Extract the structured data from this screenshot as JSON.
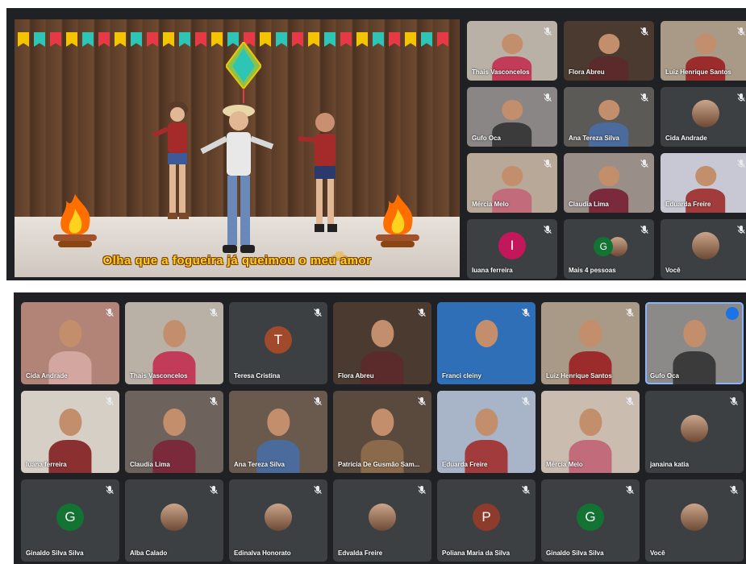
{
  "top_call": {
    "lyric": "Olha que a fogueira já queimou o meu amor",
    "tiles": [
      {
        "name": "Thais Vasconcelos",
        "kind": "video",
        "bg": "#b9b1a6",
        "shirt": "#c23b58"
      },
      {
        "name": "Flora Abreu",
        "kind": "video",
        "bg": "#4a3a30",
        "shirt": "#5b2b2b"
      },
      {
        "name": "Luiz Henrique Santos",
        "kind": "video",
        "bg": "#a89a86",
        "shirt": "#9c2b2b"
      },
      {
        "name": "Gufo Oca",
        "kind": "video",
        "bg": "#8a8686",
        "shirt": "#3b3b3b"
      },
      {
        "name": "Ana Tereza Silva",
        "kind": "video",
        "bg": "#5c5a56",
        "shirt": "#4b6b9c"
      },
      {
        "name": "Cida Andrade",
        "kind": "photo"
      },
      {
        "name": "Mércia Melo",
        "kind": "video",
        "bg": "#b8a898",
        "shirt": "#c26b7a"
      },
      {
        "name": "Claudia Lima",
        "kind": "video",
        "bg": "#9a8e88",
        "shirt": "#7a2a3a"
      },
      {
        "name": "Eduarda Freire",
        "kind": "video",
        "bg": "#c8c8d4",
        "shirt": "#a23b3b"
      },
      {
        "name": "Iuana ferreira",
        "kind": "letter",
        "letter": "I",
        "color": "#c2185b"
      },
      {
        "name": "Mais 4 pessoas",
        "kind": "more",
        "letter": "G",
        "color": "#137333"
      },
      {
        "name": "Você",
        "kind": "photo"
      }
    ]
  },
  "bottom_call": {
    "tiles": [
      {
        "name": "Cida Andrade",
        "kind": "video",
        "bg": "#b28478",
        "shirt": "#d4a6a0"
      },
      {
        "name": "Thais Vasconcelos",
        "kind": "video",
        "bg": "#b9b1a6",
        "shirt": "#c23b58"
      },
      {
        "name": "Teresa Cristina",
        "kind": "letter",
        "letter": "T",
        "color": "#a14a2b"
      },
      {
        "name": "Flora Abreu",
        "kind": "video",
        "bg": "#4a3a30",
        "shirt": "#5b2b2b"
      },
      {
        "name": "Franci cleiny",
        "kind": "video",
        "bg": "#2f6fb8",
        "shirt": "#2f6fb8"
      },
      {
        "name": "Luiz Henrique Santos",
        "kind": "video",
        "bg": "#a89a86",
        "shirt": "#9c2b2b"
      },
      {
        "name": "Gufo Oca",
        "kind": "video",
        "bg": "#8c8a88",
        "shirt": "#3b3b3b",
        "speaking": true
      },
      {
        "name": "Iuana ferreira",
        "kind": "video",
        "bg": "#d6cfc6",
        "shirt": "#8a3030"
      },
      {
        "name": "Claudia Lima",
        "kind": "video",
        "bg": "#6e625c",
        "shirt": "#7a2a3a"
      },
      {
        "name": "Ana Tereza Silva",
        "kind": "video",
        "bg": "#6a5a4e",
        "shirt": "#4b6b9c"
      },
      {
        "name": "Patricia De Gusmão Sam...",
        "kind": "video",
        "bg": "#5a4a3e",
        "shirt": "#8a6a4a"
      },
      {
        "name": "Eduarda Freire",
        "kind": "video",
        "bg": "#a8b4c8",
        "shirt": "#a23b3b"
      },
      {
        "name": "Mércia Melo",
        "kind": "video",
        "bg": "#cbbcb0",
        "shirt": "#c26b7a"
      },
      {
        "name": "janaina katia",
        "kind": "photo"
      },
      {
        "name": "Ginaldo Silva Silva",
        "kind": "letter",
        "letter": "G",
        "color": "#137333"
      },
      {
        "name": "Alba Calado",
        "kind": "photo"
      },
      {
        "name": "Edinalva Honorato",
        "kind": "photo"
      },
      {
        "name": "Edvalda Freire",
        "kind": "photo"
      },
      {
        "name": "Poliana Maria da Silva",
        "kind": "letter",
        "letter": "P",
        "color": "#8d3b2a"
      },
      {
        "name": "Ginaldo Silva Silva",
        "kind": "letter",
        "letter": "G",
        "color": "#137333"
      },
      {
        "name": "Você",
        "kind": "photo"
      }
    ]
  },
  "flag_colors": [
    "#f5c400",
    "#2ec4b6",
    "#e63946",
    "#f5c400",
    "#2ec4b6",
    "#e63946",
    "#f5c400",
    "#2ec4b6",
    "#e63946",
    "#f5c400",
    "#2ec4b6",
    "#e63946",
    "#f5c400",
    "#2ec4b6",
    "#e63946",
    "#f5c400",
    "#2ec4b6",
    "#e63946",
    "#f5c400",
    "#2ec4b6",
    "#e63946",
    "#f5c400",
    "#2ec4b6",
    "#e63946",
    "#f5c400",
    "#2ec4b6",
    "#e63946"
  ]
}
